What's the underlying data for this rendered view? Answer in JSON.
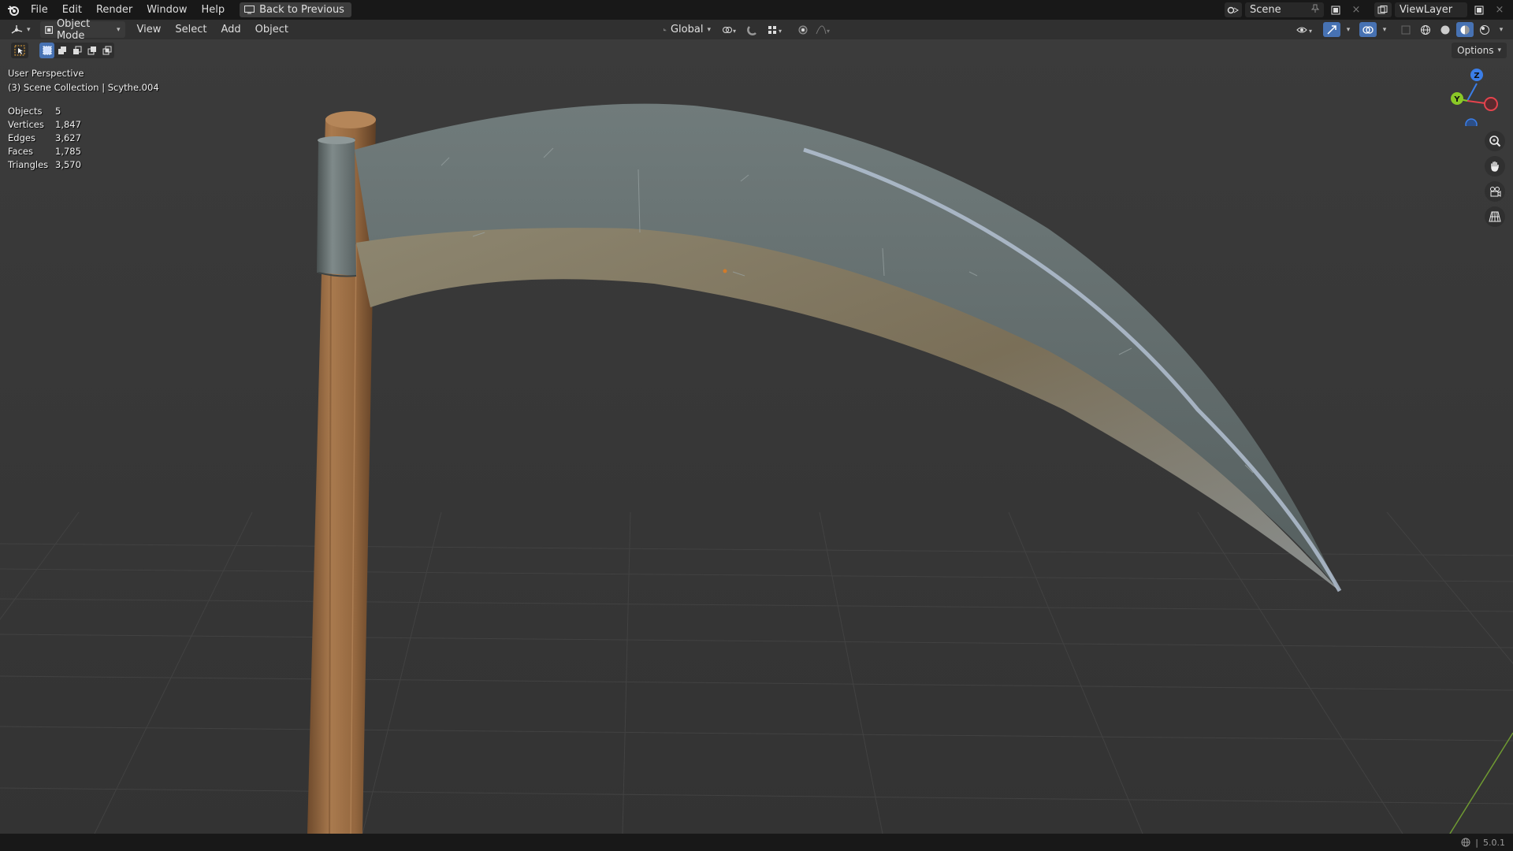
{
  "menu": {
    "items": [
      "File",
      "Edit",
      "Render",
      "Window",
      "Help"
    ],
    "back_button": "Back to Previous"
  },
  "topbar_right": {
    "scene": "Scene",
    "view_layer": "ViewLayer"
  },
  "header": {
    "mode": "Object Mode",
    "menus": [
      "View",
      "Select",
      "Add",
      "Object"
    ],
    "transform_orientation": "Global"
  },
  "viewport": {
    "options_label": "Options",
    "perspective": "User Perspective",
    "collection": "(3) Scene Collection | Scythe.004",
    "stats": [
      {
        "label": "Objects",
        "value": "5"
      },
      {
        "label": "Vertices",
        "value": "1,847"
      },
      {
        "label": "Edges",
        "value": "3,627"
      },
      {
        "label": "Faces",
        "value": "1,785"
      },
      {
        "label": "Triangles",
        "value": "3,570"
      }
    ],
    "gizmo_axes": [
      "Z",
      "Y"
    ]
  },
  "statusbar": {
    "version": "5.0.1"
  },
  "colors": {
    "accent": "#4772b3",
    "x_axis": "#e5434d",
    "y_axis": "#8ac926",
    "z_axis": "#3b7ee8"
  }
}
